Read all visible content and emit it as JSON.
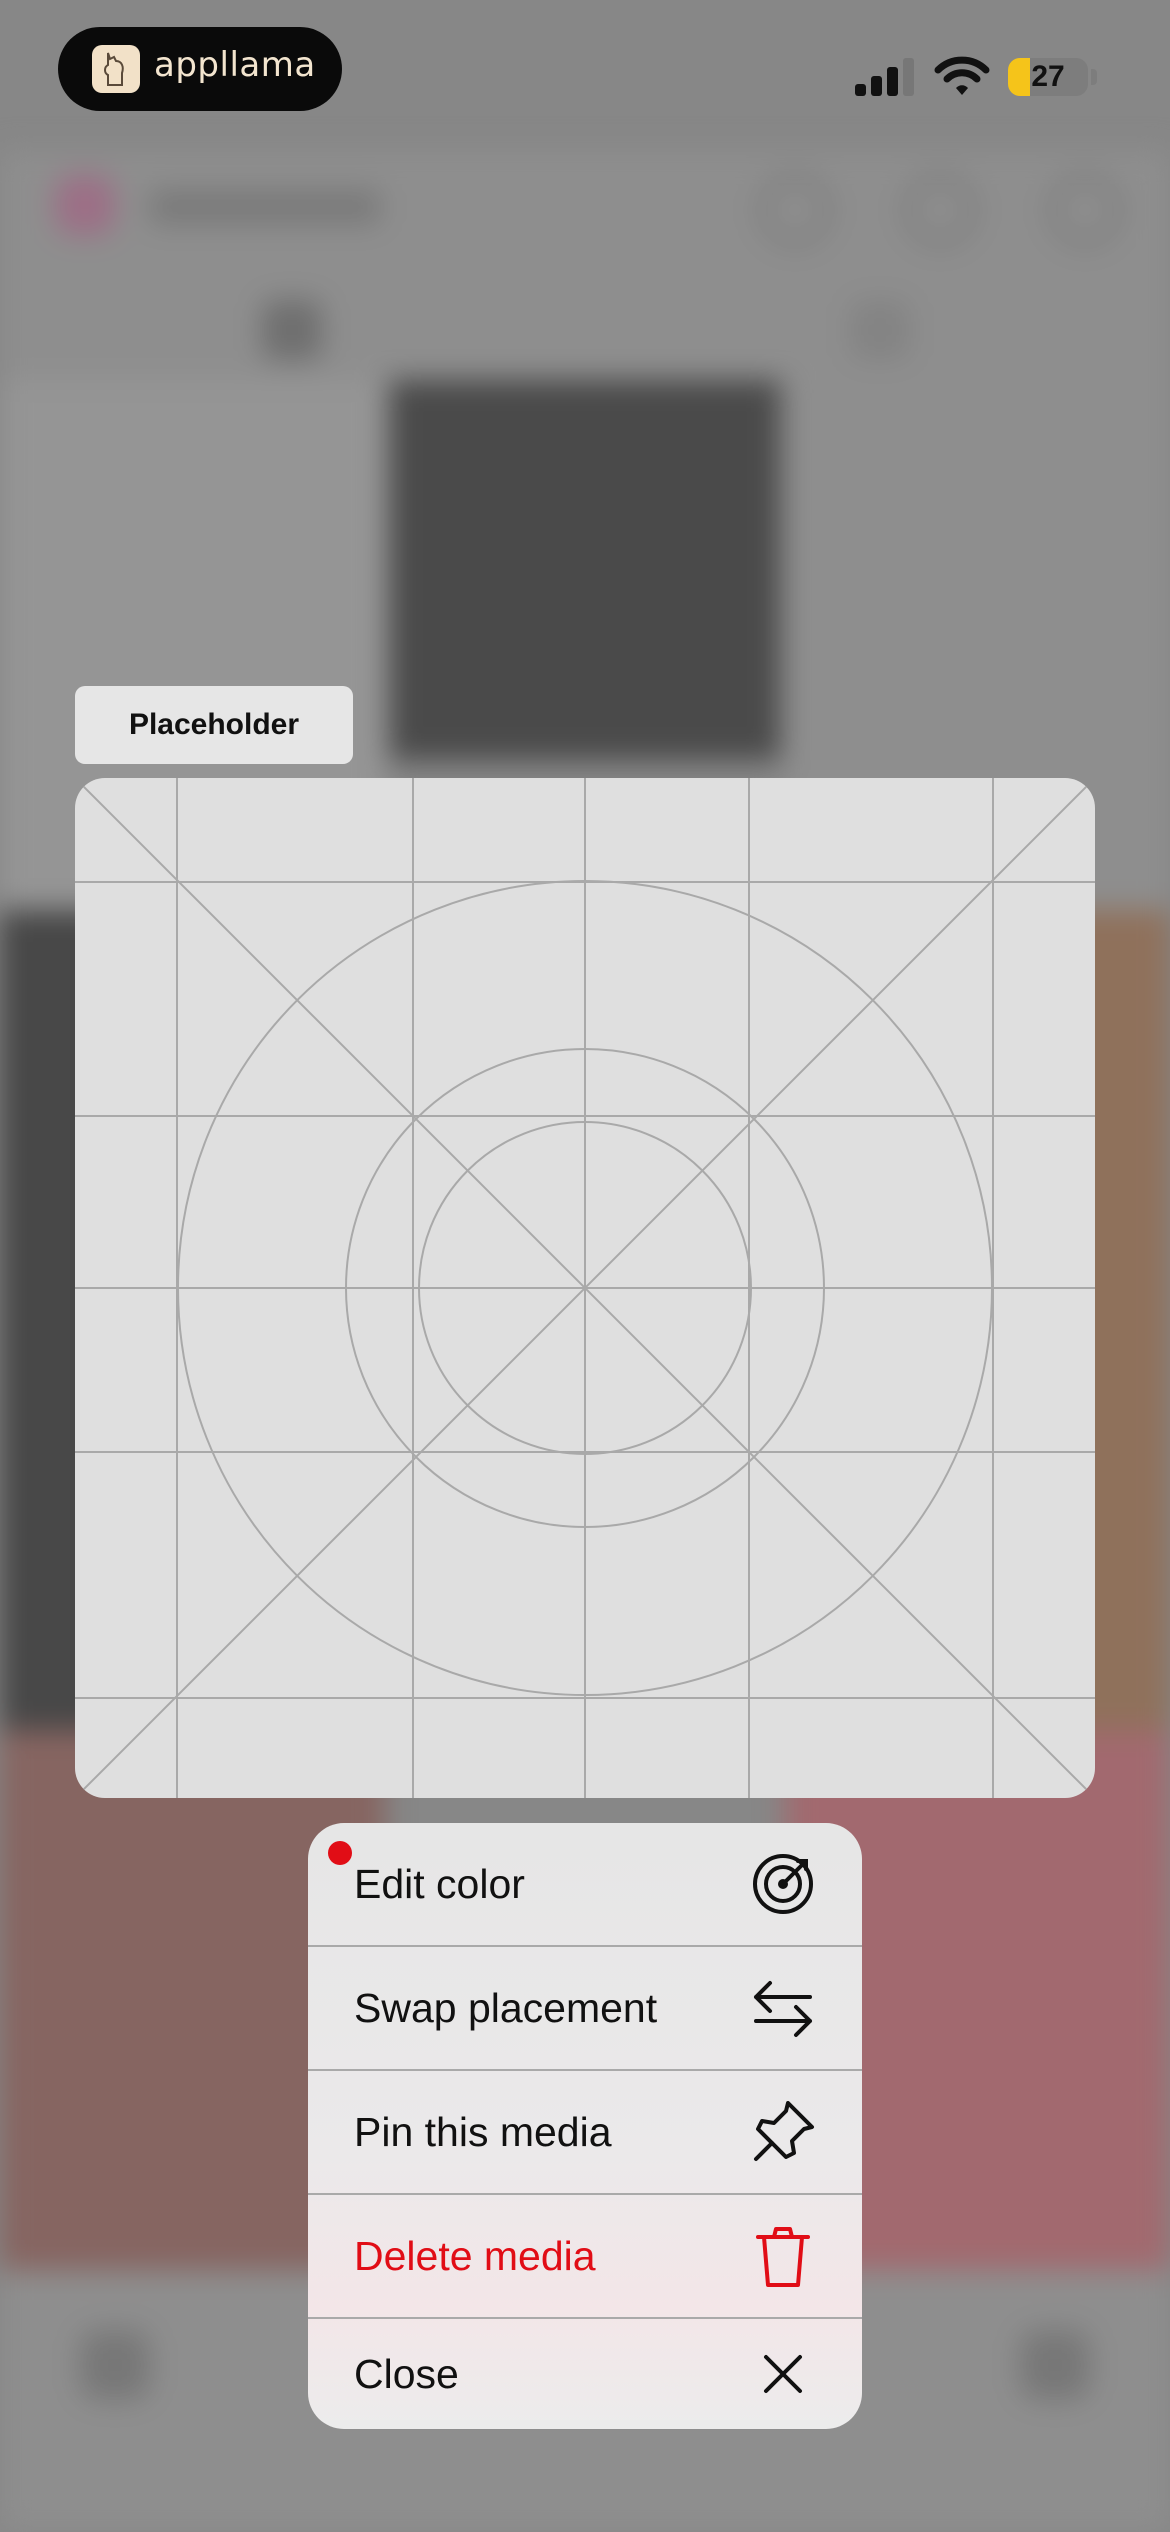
{
  "status_bar": {
    "app_brand": "appllama",
    "battery_level": "27",
    "battery_fraction": 0.27
  },
  "placeholder": {
    "label": "Placeholder"
  },
  "context_menu": {
    "items": [
      {
        "label": "Edit color",
        "icon": "color-target-icon",
        "destructive": false,
        "badge": true
      },
      {
        "label": "Swap placement",
        "icon": "swap-arrows-icon",
        "destructive": false,
        "badge": false
      },
      {
        "label": "Pin this media",
        "icon": "pin-icon",
        "destructive": false,
        "badge": false
      },
      {
        "label": "Delete media",
        "icon": "trash-icon",
        "destructive": true,
        "badge": false
      },
      {
        "label": "Close",
        "icon": "close-icon",
        "destructive": false,
        "badge": false
      }
    ]
  },
  "colors": {
    "destructive": "#e10d16",
    "battery": "#f5c41a",
    "menu_bg": "#e8e8e8"
  }
}
